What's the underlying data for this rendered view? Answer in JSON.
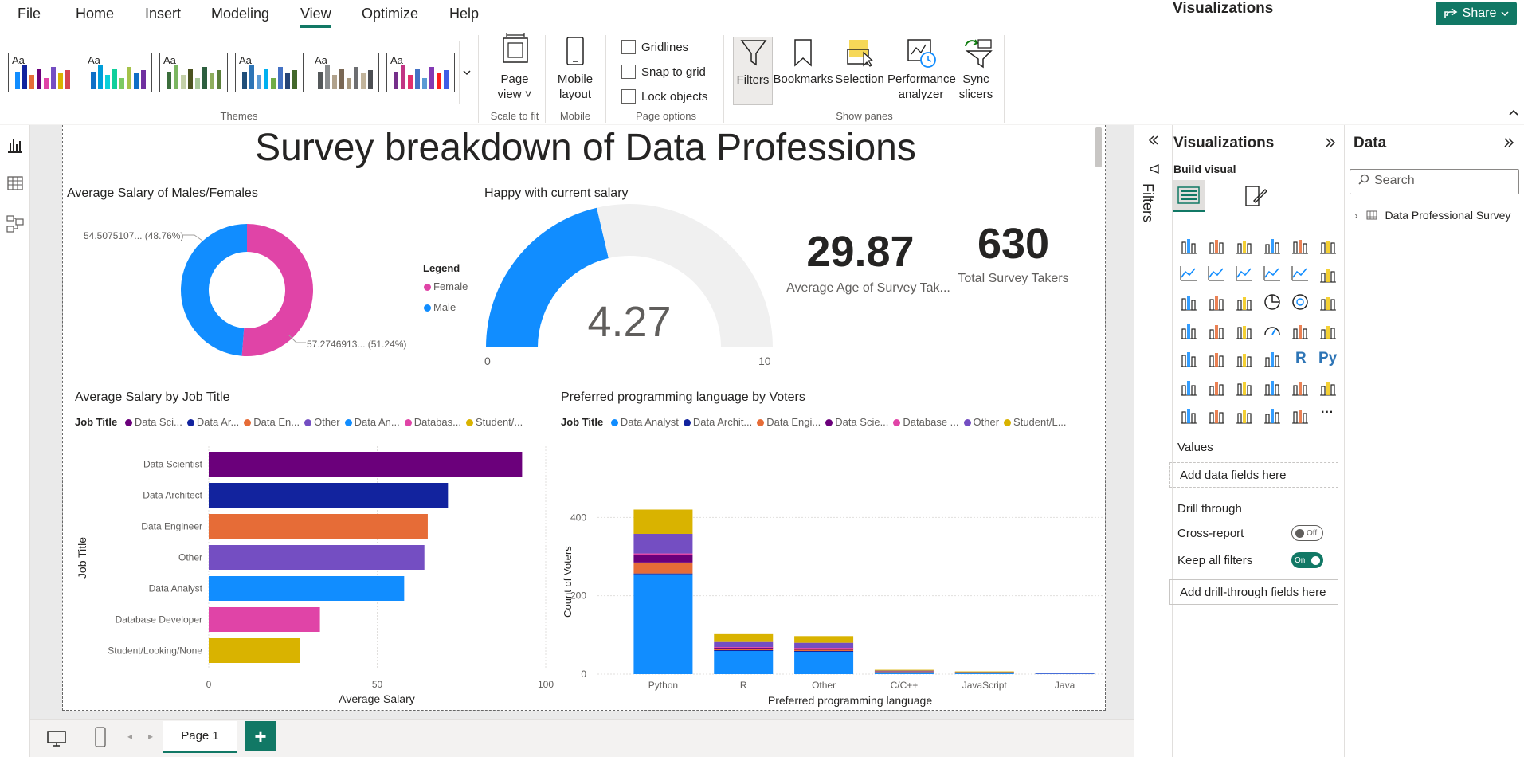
{
  "menu": [
    "File",
    "Home",
    "Insert",
    "Modeling",
    "View",
    "Optimize",
    "Help"
  ],
  "share_label": "Share",
  "ribbon": {
    "theme_text": "Aa",
    "themes_label": "Themes",
    "page_view": [
      "Page",
      "view"
    ],
    "scale_label": "Scale to fit",
    "mobile_layout": [
      "Mobile",
      "layout"
    ],
    "mobile_label": "Mobile",
    "gridlines": "Gridlines",
    "snap": "Snap to grid",
    "lock": "Lock objects",
    "page_options_label": "Page options",
    "filters": "Filters",
    "bookmarks": "Bookmarks",
    "selection": "Selection",
    "performance": [
      "Performance",
      "analyzer"
    ],
    "sync": [
      "Sync",
      "slicers"
    ],
    "show_panes_label": "Show panes"
  },
  "report": {
    "title": "Survey breakdown of Data Professions",
    "donut": {
      "title": "Average Salary of Males/Females",
      "label_male": "54.5075107... (48.76%)",
      "label_female": "57.2746913... (51.24%)",
      "legend_title": "Legend",
      "legend": [
        "Female",
        "Male"
      ],
      "colors": {
        "female": "#e044a7",
        "male": "#118dff"
      },
      "chart_data": {
        "type": "pie",
        "categories": [
          "Female",
          "Male"
        ],
        "values": [
          57.2746913,
          54.5075107
        ],
        "percents": [
          51.24,
          48.76
        ]
      }
    },
    "gauge": {
      "title": "Happy with current salary",
      "value_label": "4.27",
      "min_label": "0",
      "max_label": "10",
      "chart_data": {
        "type": "gauge",
        "value": 4.27,
        "min": 0,
        "max": 10
      }
    },
    "kpi1": {
      "value": "29.87",
      "label": "Average Age of Survey Tak..."
    },
    "kpi2": {
      "value": "630",
      "label": "Total Survey Takers"
    },
    "bar_chart": {
      "title": "Average Salary by Job Title",
      "legend_title": "Job Title",
      "legend": [
        "Data Sci...",
        "Data Ar...",
        "Data En...",
        "Other",
        "Data An...",
        "Databas...",
        "Student/..."
      ],
      "xlabel": "Average Salary",
      "ylabel": "Job Title",
      "x_ticks": [
        "0",
        "50",
        "100"
      ],
      "chart_data": {
        "type": "bar",
        "orientation": "horizontal",
        "categories": [
          "Data Scientist",
          "Data Architect",
          "Data Engineer",
          "Other",
          "Data Analyst",
          "Database Developer",
          "Student/Looking/None"
        ],
        "values": [
          93,
          71,
          65,
          64,
          58,
          33,
          27
        ],
        "colors": [
          "#6b007b",
          "#12239e",
          "#e66c37",
          "#744ec2",
          "#118dff",
          "#e044a7",
          "#d9b300"
        ],
        "xlim": [
          0,
          100
        ]
      }
    },
    "stack_chart": {
      "title": "Preferred programming language by Voters",
      "legend_title": "Job Title",
      "legend": [
        "Data Analyst",
        "Data Archit...",
        "Data Engi...",
        "Data Scie...",
        "Database ...",
        "Other",
        "Student/L..."
      ],
      "xlabel": "Preferred programming language",
      "ylabel": "Count of Voters",
      "y_ticks": [
        "400",
        "200",
        "0"
      ],
      "chart_data": {
        "type": "bar",
        "stacked": true,
        "categories": [
          "Python",
          "R",
          "Other",
          "C/C++",
          "JavaScript",
          "Java"
        ],
        "series": [
          {
            "name": "Data Analyst",
            "color": "#118dff",
            "values": [
              255,
              60,
              58,
              6,
              2,
              2
            ]
          },
          {
            "name": "Data Architect",
            "color": "#12239e",
            "values": [
              2,
              1,
              1,
              0,
              0,
              0
            ]
          },
          {
            "name": "Data Engineer",
            "color": "#e66c37",
            "values": [
              28,
              3,
              3,
              1,
              2,
              0
            ]
          },
          {
            "name": "Data Scientist",
            "color": "#6b007b",
            "values": [
              20,
              4,
              4,
              0,
              0,
              0
            ]
          },
          {
            "name": "Database Developer",
            "color": "#e044a7",
            "values": [
              3,
              1,
              1,
              0,
              1,
              0
            ]
          },
          {
            "name": "Other",
            "color": "#744ec2",
            "values": [
              50,
              13,
              13,
              2,
              1,
              1
            ]
          },
          {
            "name": "Student/Looking/None",
            "color": "#d9b300",
            "values": [
              62,
              20,
              17,
              2,
              1,
              1
            ]
          }
        ],
        "ylim": [
          0,
          480
        ]
      }
    }
  },
  "bottom": {
    "page_tab": "Page 1",
    "add": "+"
  },
  "filters_pane": {
    "label": "Filters"
  },
  "viz_pane": {
    "title": "Visualizations",
    "build_visual": "Build visual",
    "values_label": "Values",
    "values_well": "Add data fields here",
    "drill_label": "Drill through",
    "cross_report": "Cross-report",
    "cross_state": "Off",
    "keep_filters": "Keep all filters",
    "keep_state": "On",
    "drill_well": "Add drill-through fields here",
    "py_label": "Py",
    "r_label": "R",
    "more": "···"
  },
  "data_pane": {
    "title": "Data",
    "search_placeholder": "Search",
    "table": "Data Professional Survey"
  }
}
